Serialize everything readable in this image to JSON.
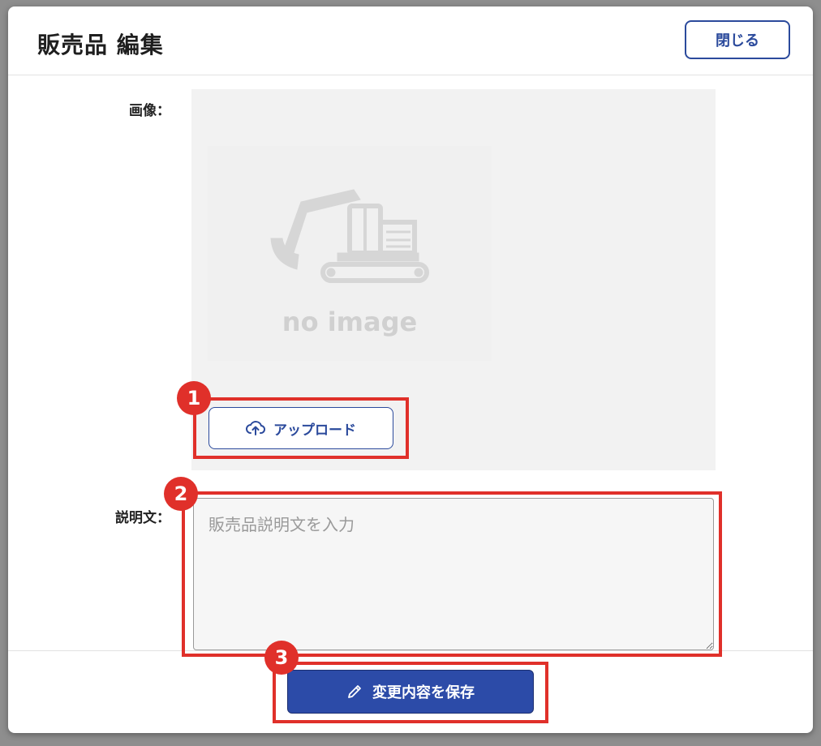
{
  "dialog": {
    "title": "販売品 編集",
    "close_label": "閉じる"
  },
  "form": {
    "image_label": "画像：",
    "no_image_text": "no image",
    "upload_label": "アップロード",
    "description_label": "説明文：",
    "description_placeholder": "販売品説明文を入力",
    "description_value": ""
  },
  "footer": {
    "save_label": "変更内容を保存"
  },
  "annotations": {
    "badges": [
      "1",
      "2",
      "3"
    ],
    "highlight_color": "#e0302a"
  },
  "colors": {
    "primary": "#2c4ba8",
    "outline": "#2b4a9c"
  },
  "icons": {
    "upload": "cloud-upload-icon",
    "save": "pencil-icon",
    "placeholder": "excavator-icon"
  }
}
